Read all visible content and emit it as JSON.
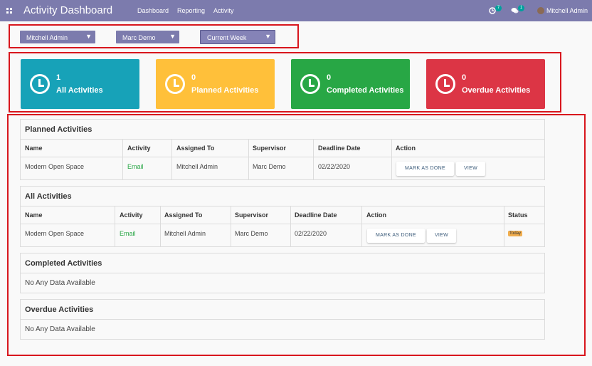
{
  "topbar": {
    "title": "Activity Dashboard",
    "nav": [
      "Dashboard",
      "Reporting",
      "Activity"
    ],
    "activity_count": "7",
    "message_count": "1",
    "user_name": "Mitchell Admin"
  },
  "filters": {
    "user": "Mitchell Admin",
    "supervisor": "Marc Demo",
    "period": "Current Week"
  },
  "cards": [
    {
      "count": "1",
      "label": "All Activities",
      "color": "#17a2b8"
    },
    {
      "count": "0",
      "label": "Planned Activities",
      "color": "#ffc03a"
    },
    {
      "count": "0",
      "label": "Completed Activities",
      "color": "#28a745"
    },
    {
      "count": "0",
      "label": "Overdue Activities",
      "color": "#dc3545"
    }
  ],
  "planned": {
    "title": "Planned Activities",
    "headers": [
      "Name",
      "Activity",
      "Assigned To",
      "Supervisor",
      "Deadline Date",
      "Action"
    ],
    "row": {
      "name": "Modern Open Space",
      "activity": "Email",
      "assigned_to": "Mitchell Admin",
      "supervisor": "Marc Demo",
      "deadline": "02/22/2020",
      "done_label": "MARK AS DONE",
      "view_label": "VIEW"
    }
  },
  "all": {
    "title": "All Activities",
    "headers": [
      "Name",
      "Activity",
      "Assigned To",
      "Supervisor",
      "Deadline Date",
      "Action",
      "Status"
    ],
    "row": {
      "name": "Modern Open Space",
      "activity": "Email",
      "assigned_to": "Mitchell Admin",
      "supervisor": "Marc Demo",
      "deadline": "02/22/2020",
      "done_label": "MARK AS DONE",
      "view_label": "VIEW",
      "status": "Today"
    }
  },
  "completed": {
    "title": "Completed Activities",
    "empty": "No Any Data Available"
  },
  "overdue": {
    "title": "Overdue Activities",
    "empty": "No Any Data Available"
  }
}
